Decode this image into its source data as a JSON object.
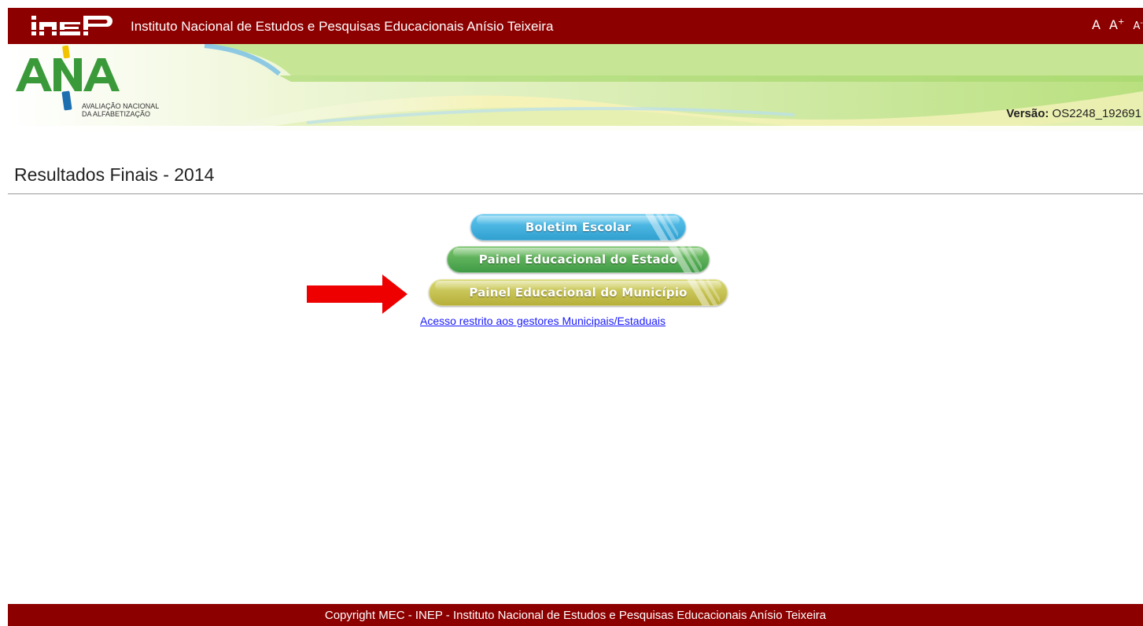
{
  "header": {
    "logo_text": "inep",
    "title": "Instituto Nacional de Estudos e Pesquisas Educacionais Anísio Teixeira",
    "font_normal": "A",
    "font_increase": "A",
    "font_increase_sup": "+",
    "font_decrease": "A",
    "font_decrease_sup": "-"
  },
  "banner": {
    "logo_text": "ANA",
    "logo_subtitle_1": "AVALIAÇÃO NACIONAL",
    "logo_subtitle_2": "DA ALFABETIZAÇÃO",
    "version_label": "Versão:",
    "version_value": " OS2248_192691"
  },
  "main": {
    "title": "Resultados Finais - 2014",
    "buttons": [
      {
        "label": "Boletim Escolar",
        "color": "#3fb0dc"
      },
      {
        "label": "Painel Educacional do Estado",
        "color": "#55ad55"
      },
      {
        "label": "Painel Educacional do Município",
        "color": "#c8c24e"
      }
    ],
    "restricted_link": "Acesso restrito aos gestores Municipais/Estaduais",
    "arrow_color": "#ee0000"
  },
  "footer": {
    "copyright": "Copyright MEC - INEP - Instituto Nacional de Estudos e Pesquisas Educacionais Anísio Teixeira"
  },
  "colors": {
    "brand_red": "#8d0000",
    "link": "#1a1aff"
  }
}
